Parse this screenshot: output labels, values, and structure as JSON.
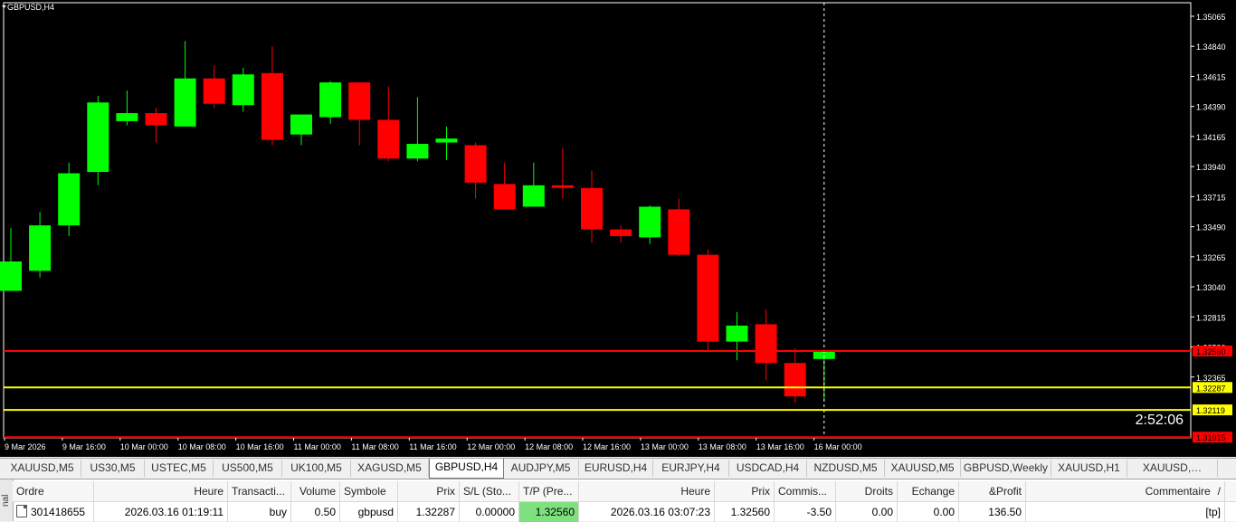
{
  "chart": {
    "symbol_label": "GBPUSD,H4",
    "timer": "2:52:06",
    "price_max": 1.35065,
    "price_min": 1.3193,
    "y_ticks": [
      "1.35065",
      "1.34840",
      "1.34615",
      "1.34390",
      "1.34165",
      "1.33940",
      "1.33715",
      "1.33490",
      "1.33265",
      "1.33040",
      "1.32815",
      "1.32590",
      "1.32365"
    ],
    "x_labels": [
      "9 Mar 2026",
      "9 Mar 16:00",
      "10 Mar 00:00",
      "10 Mar 08:00",
      "10 Mar 16:00",
      "11 Mar 00:00",
      "11 Mar 08:00",
      "11 Mar 16:00",
      "12 Mar 00:00",
      "12 Mar 08:00",
      "12 Mar 16:00",
      "13 Mar 00:00",
      "13 Mar 08:00",
      "13 Mar 16:00",
      "16 Mar 00:00"
    ],
    "lines": [
      {
        "name": "tp-line",
        "price": 1.3256,
        "label": "1.32560",
        "color": "#ff0000",
        "label_bg": "#ff0000",
        "label_color": "#000000"
      },
      {
        "name": "entry-line",
        "price": 1.32287,
        "label": "1.32287",
        "color": "#ffff00",
        "label_bg": "#ffff00",
        "label_color": "#000000"
      },
      {
        "name": "bid-line",
        "price": 1.32119,
        "label": "1.32119",
        "color": "#ffff00",
        "label_bg": "#ffff00",
        "label_color": "#000000"
      },
      {
        "name": "sl-line",
        "price": 1.31915,
        "label": "1.31915",
        "color": "#ff0000",
        "label_bg": "#ff0000",
        "label_color": "#000000"
      }
    ],
    "colors": {
      "bull": "#00ff00",
      "bear": "#ff0000",
      "background": "#000000",
      "axis": "#ffffff"
    }
  },
  "chart_data": {
    "type": "candlestick",
    "symbol": "GBPUSD",
    "timeframe": "H4",
    "candles": [
      {
        "o": 1.3301,
        "h": 1.3348,
        "l": 1.3301,
        "c": 1.3323
      },
      {
        "o": 1.3316,
        "h": 1.336,
        "l": 1.3311,
        "c": 1.335
      },
      {
        "o": 1.335,
        "h": 1.3397,
        "l": 1.3342,
        "c": 1.3389
      },
      {
        "o": 1.339,
        "h": 1.3447,
        "l": 1.338,
        "c": 1.3442
      },
      {
        "o": 1.3428,
        "h": 1.3451,
        "l": 1.3425,
        "c": 1.3434
      },
      {
        "o": 1.3434,
        "h": 1.3438,
        "l": 1.3412,
        "c": 1.3425
      },
      {
        "o": 1.3424,
        "h": 1.3488,
        "l": 1.3424,
        "c": 1.346
      },
      {
        "o": 1.346,
        "h": 1.347,
        "l": 1.3438,
        "c": 1.3441
      },
      {
        "o": 1.344,
        "h": 1.3468,
        "l": 1.3435,
        "c": 1.3463
      },
      {
        "o": 1.3464,
        "h": 1.3484,
        "l": 1.341,
        "c": 1.3414
      },
      {
        "o": 1.3418,
        "h": 1.3433,
        "l": 1.341,
        "c": 1.3433
      },
      {
        "o": 1.3431,
        "h": 1.3458,
        "l": 1.3426,
        "c": 1.3457
      },
      {
        "o": 1.3457,
        "h": 1.3457,
        "l": 1.341,
        "c": 1.3429
      },
      {
        "o": 1.3429,
        "h": 1.3454,
        "l": 1.3398,
        "c": 1.34
      },
      {
        "o": 1.34,
        "h": 1.3446,
        "l": 1.3398,
        "c": 1.3411
      },
      {
        "o": 1.3412,
        "h": 1.3424,
        "l": 1.3399,
        "c": 1.3415
      },
      {
        "o": 1.341,
        "h": 1.3412,
        "l": 1.337,
        "c": 1.3382
      },
      {
        "o": 1.3381,
        "h": 1.3397,
        "l": 1.3364,
        "c": 1.3362
      },
      {
        "o": 1.3364,
        "h": 1.3397,
        "l": 1.3364,
        "c": 1.338
      },
      {
        "o": 1.338,
        "h": 1.3408,
        "l": 1.337,
        "c": 1.3378
      },
      {
        "o": 1.3378,
        "h": 1.3391,
        "l": 1.3337,
        "c": 1.3347
      },
      {
        "o": 1.3347,
        "h": 1.335,
        "l": 1.3337,
        "c": 1.3342
      },
      {
        "o": 1.3341,
        "h": 1.3365,
        "l": 1.3336,
        "c": 1.3364
      },
      {
        "o": 1.3362,
        "h": 1.337,
        "l": 1.3327,
        "c": 1.3328
      },
      {
        "o": 1.3328,
        "h": 1.3332,
        "l": 1.3256,
        "c": 1.3263
      },
      {
        "o": 1.3263,
        "h": 1.3285,
        "l": 1.3249,
        "c": 1.3275
      },
      {
        "o": 1.3276,
        "h": 1.3287,
        "l": 1.3234,
        "c": 1.3247
      },
      {
        "o": 1.3247,
        "h": 1.3258,
        "l": 1.3217,
        "c": 1.3222
      },
      {
        "o": 1.325,
        "h": 1.3257,
        "l": 1.3219,
        "c": 1.3256
      }
    ],
    "current_price": 1.3256
  },
  "tabs": [
    "XAUUSD,M5",
    "US30,M5",
    "USTEC,M5",
    "US500,M5",
    "UK100,M5",
    "XAGUSD,M5",
    "GBPUSD,H4",
    "AUDJPY,M5",
    "EURUSD,H4",
    "EURJPY,H4",
    "USDCAD,H4",
    "NZDUSD,M5",
    "XAUUSD,M5",
    "GBPUSD,Weekly",
    "XAUUSD,H1",
    "XAUUSD,…"
  ],
  "active_tab": 6,
  "terminal": {
    "side_label": "nal",
    "headers": [
      "Ordre",
      "Heure",
      "Transacti...",
      "Volume",
      "Symbole",
      "Prix",
      "S/L (Sto...",
      "T/P (Pre...",
      "Heure",
      "Prix",
      "Commis...",
      "Droits",
      "Echange",
      "&Profit",
      "Commentaire"
    ],
    "sort_indicator": "/",
    "row": [
      "301418655",
      "2026.03.16 01:19:11",
      "buy",
      "0.50",
      "gbpusd",
      "1.32287",
      "0.00000",
      "1.32560",
      "2026.03.16 03:07:23",
      "1.32560",
      "-3.50",
      "0.00",
      "0.00",
      "136.50",
      "[tp]"
    ]
  }
}
